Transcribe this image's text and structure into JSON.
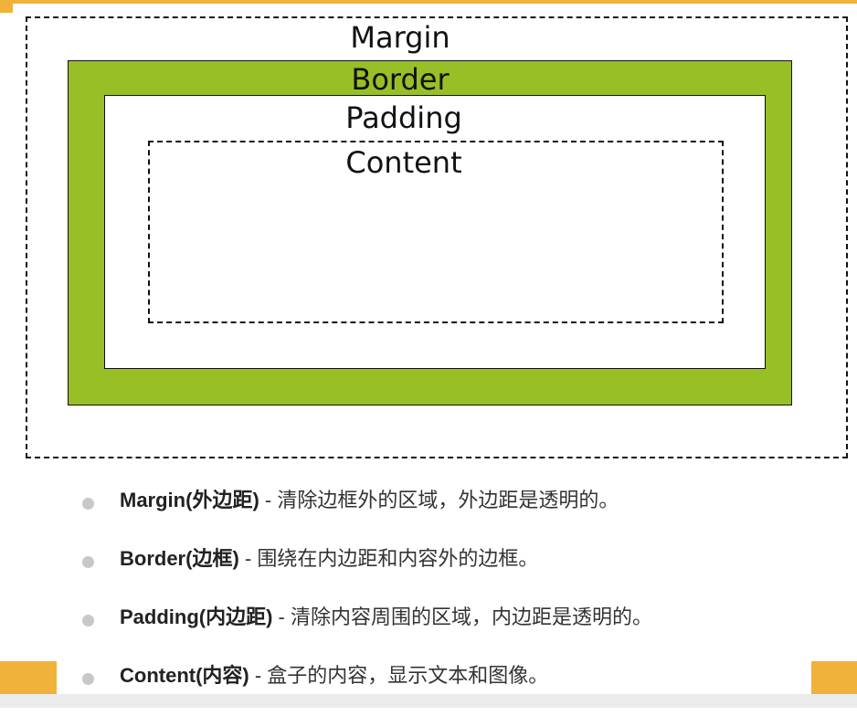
{
  "diagram": {
    "labels": {
      "margin": "Margin",
      "border": "Border",
      "padding": "Padding",
      "content": "Content"
    },
    "colors": {
      "border_fill": "#99bf26",
      "accent": "#f0b23b",
      "outline": "#111111"
    }
  },
  "definitions": [
    {
      "term": "Margin(外边距)",
      "desc": " - 清除边框外的区域，外边距是透明的。"
    },
    {
      "term": "Border(边框)",
      "desc": " - 围绕在内边距和内容外的边框。"
    },
    {
      "term": "Padding(内边距)",
      "desc": " - 清除内容周围的区域，内边距是透明的。"
    },
    {
      "term": "Content(内容)",
      "desc": " - 盒子的内容，显示文本和图像。"
    }
  ]
}
